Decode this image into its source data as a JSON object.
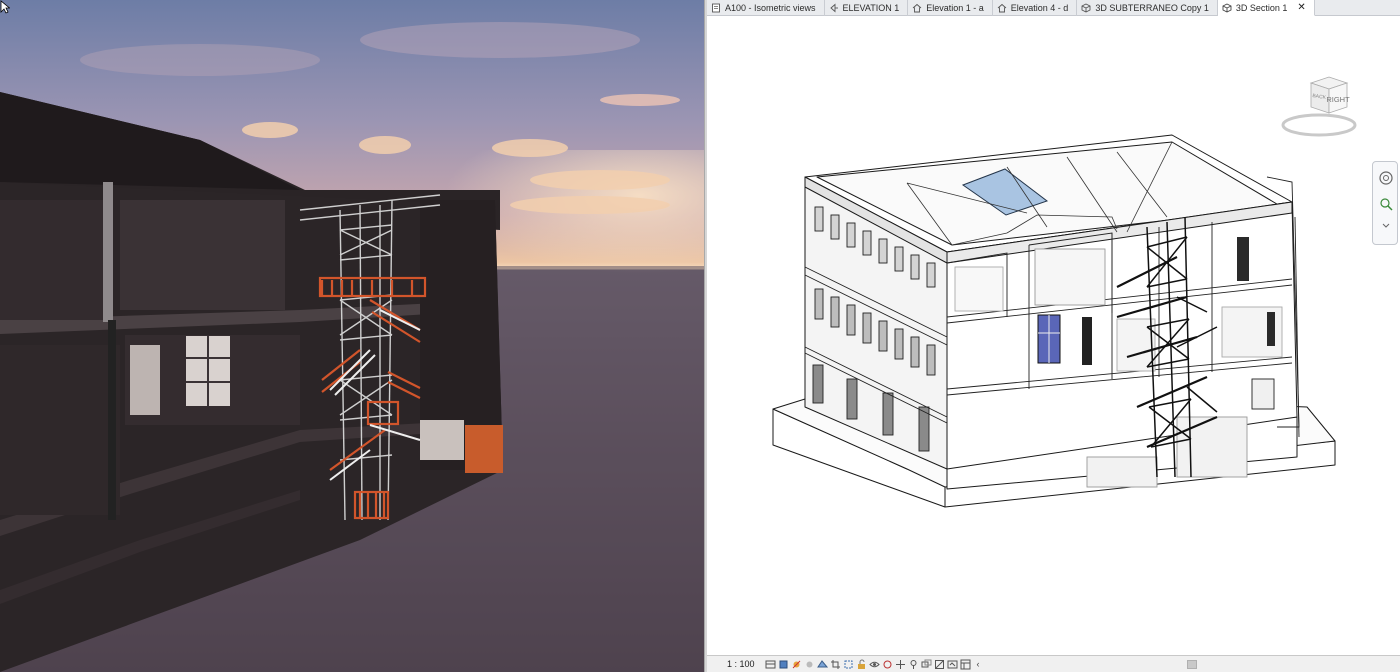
{
  "tabs": [
    {
      "label": "A100 - Isometric views",
      "icon": "sheet-icon",
      "active": false
    },
    {
      "label": "ELEVATION 1",
      "icon": "elevation-icon",
      "active": false
    },
    {
      "label": "Elevation 1 - a",
      "icon": "house-icon",
      "active": false
    },
    {
      "label": "Elevation 4 - d",
      "icon": "house-icon",
      "active": false
    },
    {
      "label": "3D SUBTERRANEO Copy 1",
      "icon": "3d-view-icon",
      "active": false
    },
    {
      "label": "3D Section 1",
      "icon": "3d-view-icon",
      "active": true
    }
  ],
  "tab_close": "✕",
  "viewcube": {
    "face": "RIGHT",
    "side": "BACK"
  },
  "status": {
    "scale": "1 : 100",
    "scroll_left": "‹"
  },
  "colors": {
    "accent_orange": "#d2552b",
    "skylight_blue": "#a9c4e2",
    "sky_top": "#6d7da6",
    "sky_horizon": "#f7dcbd"
  }
}
